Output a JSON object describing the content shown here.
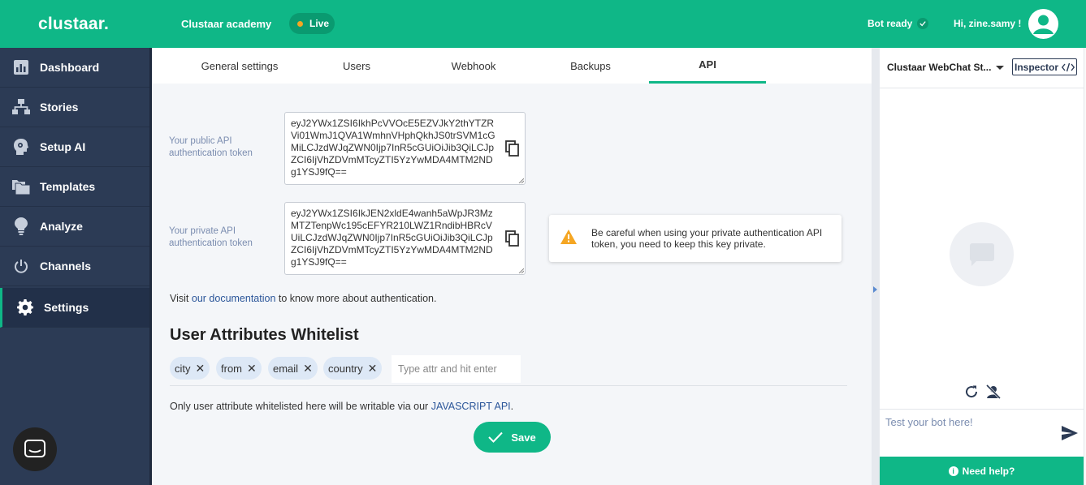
{
  "topbar": {
    "logo": "clustaar.",
    "project_name": "Clustaar academy",
    "status_badge": "Live",
    "bot_status": "Bot ready",
    "greeting": "Hi, zine.samy !"
  },
  "sidebar": {
    "items": [
      {
        "label": "Dashboard",
        "icon": "bar-chart-icon"
      },
      {
        "label": "Stories",
        "icon": "sitemap-icon"
      },
      {
        "label": "Setup AI",
        "icon": "head-gear-icon"
      },
      {
        "label": "Templates",
        "icon": "folders-icon"
      },
      {
        "label": "Analyze",
        "icon": "lightbulb-icon"
      },
      {
        "label": "Channels",
        "icon": "power-icon"
      },
      {
        "label": "Settings",
        "icon": "gear-icon",
        "active": true
      }
    ]
  },
  "tabs": [
    {
      "label": "General settings"
    },
    {
      "label": "Users"
    },
    {
      "label": "Webhook"
    },
    {
      "label": "Backups"
    },
    {
      "label": "API",
      "active": true
    }
  ],
  "api": {
    "public_label": "Your public API authentication token",
    "public_token": "eyJ2YWx1ZSI6IkhPcVVOcE5EZVJkY2thYTZRVi01WmJ1QVA1WmhnVHphQkhJS0trSVM1cGMiLCJzdWJqZWN0Ijp7InR5cGUiOiJib3QiLCJpZCI6IjVhZDVmMTcyZTI5YzYwMDA4MTM2NDg1YSJ9fQ==",
    "private_label": "Your private API authentication token",
    "private_token": "eyJ2YWx1ZSI6IkJEN2xldE4wanh5aWpJR3MzMTZTenpWc195cEFYR210LWZ1RndibHBRcVUiLCJzdWJqZWN0Ijp7InR5cGUiOiJib3QiLCJpZCI6IjVhZDVmMTcyZTI5YzYwMDA4MTM2NDg1YSJ9fQ==",
    "warning": "Be careful when using your private authentication API token, you need to keep this key private.",
    "doc_prefix": "Visit ",
    "doc_link": "our documentation",
    "doc_suffix": " to know more about authentication."
  },
  "whitelist": {
    "title": "User Attributes Whitelist",
    "tags": [
      "city",
      "from",
      "email",
      "country"
    ],
    "input_placeholder": "Type attr and hit enter",
    "note_prefix": "Only user attribute whitelisted here will be writable via our ",
    "note_link": "JAVASCRIPT API",
    "note_suffix": ".",
    "save_label": "Save"
  },
  "right_panel": {
    "title": "Clustaar WebChat St...",
    "inspector_label": "Inspector",
    "input_placeholder": "Test your bot here!",
    "help_label": "Need help?"
  },
  "colors": {
    "brand": "#0fb787",
    "sidebar": "#2c3b55",
    "warning": "#f5a623"
  }
}
